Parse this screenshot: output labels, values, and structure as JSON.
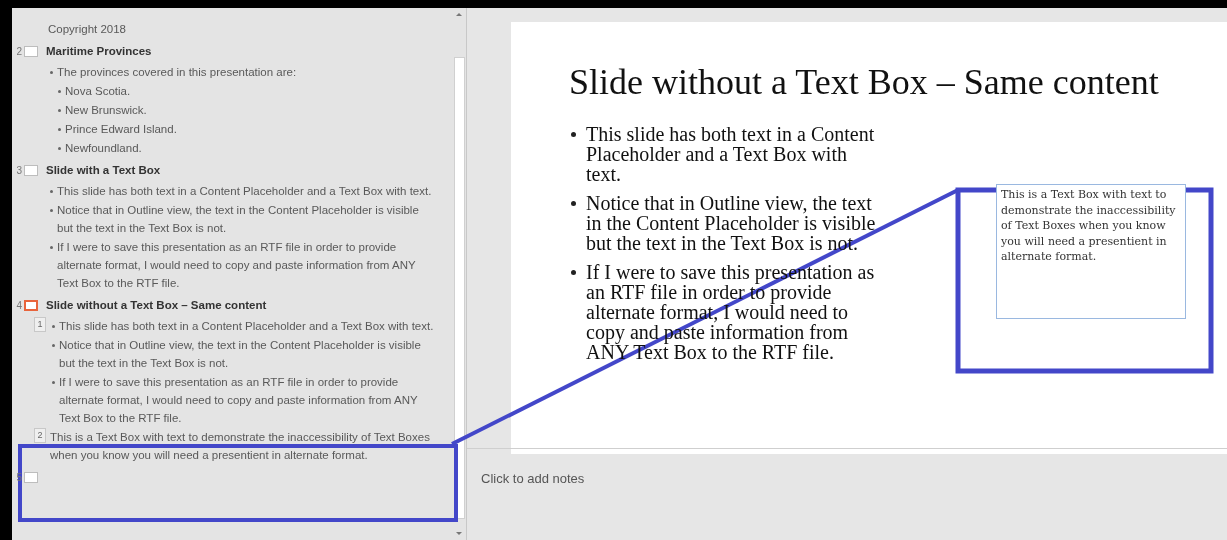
{
  "outline": {
    "slides": [
      {
        "blocks": [
          {
            "kind": "plain",
            "lines": [
              {
                "text": "Copyright 2018"
              }
            ]
          }
        ]
      },
      {
        "number": "2",
        "selected": false,
        "title": "Maritime Provinces",
        "blocks": [
          {
            "kind": "bullets",
            "lines": [
              {
                "text": "The provinces covered in this presentation are:",
                "children": [
                  {
                    "text": "Nova Scotia."
                  },
                  {
                    "text": "New Brunswick."
                  },
                  {
                    "text": "Prince Edward Island."
                  },
                  {
                    "text": "Newfoundland."
                  }
                ]
              }
            ]
          }
        ]
      },
      {
        "number": "3",
        "selected": false,
        "title": "Slide with a Text Box",
        "blocks": [
          {
            "kind": "bullets",
            "lines": [
              {
                "text": "This slide has both text in a Content Placeholder and a Text Box with text."
              },
              {
                "text": "Notice that in Outline view,  the text in the Content Placeholder is visible but the text in the Text Box is not."
              },
              {
                "text": "If I were to save this presentation as an RTF file in order to provide alternate format, I would need to copy and paste information from ANY Text Box to the RTF file."
              }
            ]
          }
        ]
      },
      {
        "number": "4",
        "selected": true,
        "title": "Slide without a Text Box – Same content",
        "blocks": [
          {
            "tag": "1",
            "kind": "bullets",
            "lines": [
              {
                "text": "This slide has both text in a Content Placeholder and a Text Box with text."
              },
              {
                "text": "Notice that in Outline view,  the text in the Content Placeholder is visible but the text in the Text Box is not."
              },
              {
                "text": "If I were to save this presentation as an RTF file in order to provide alternate format, I would need to copy and paste information from ANY Text Box to the RTF file."
              }
            ]
          },
          {
            "tag": "2",
            "kind": "plain",
            "lines": [
              {
                "text": "This is a Text Box with text to demonstrate the inaccessibility of Text Boxes when you know you will need a presentient in alternate format."
              }
            ]
          }
        ]
      },
      {
        "number": "5",
        "selected": false
      }
    ]
  },
  "slide": {
    "title": "Slide without a Text Box – Same content",
    "bullets": [
      "This slide has both text in a Content Placeholder and a Text Box with text.",
      "Notice that in Outline view, the text in the Content Placeholder is visible but the text in the Text Box is not.",
      "If I were to save this presentation as an RTF file in order to provide alternate format, I would need to copy and paste information from ANY Text Box to the RTF file."
    ],
    "text_box": "This is a Text Box with text to demonstrate the inaccessibility  of Text Boxes when you know you will need a presentient in alternate format."
  },
  "notes": {
    "placeholder": "Click to add notes"
  }
}
